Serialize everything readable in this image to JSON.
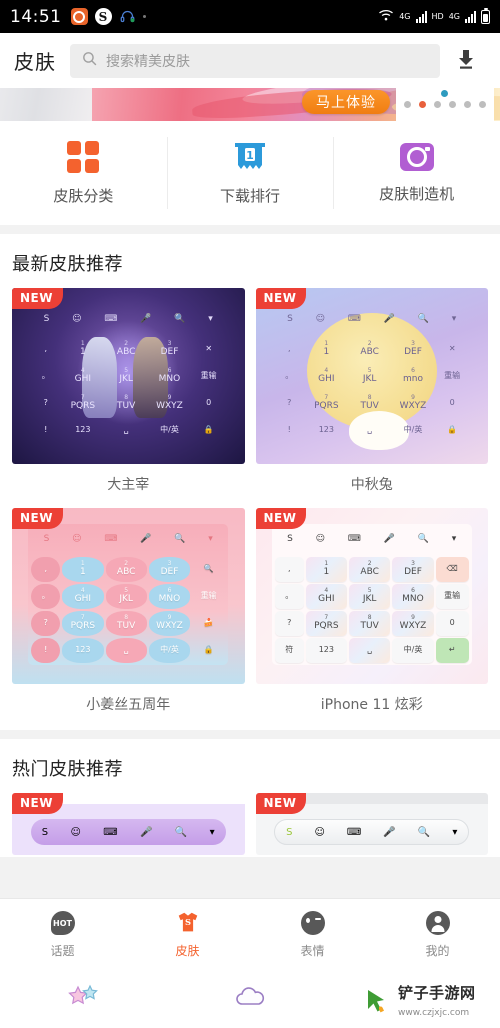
{
  "statusbar": {
    "time": "14:51",
    "left_icons": [
      "camera-app-icon",
      "s-app-icon",
      "headphone-icon",
      "dot-indicator"
    ],
    "right_icons": [
      "wifi-icon",
      "4g-signal-icon",
      "hd-icon",
      "4g-signal-2-icon",
      "battery-icon"
    ],
    "hd_label": "HD",
    "net_label": "4G"
  },
  "header": {
    "title": "皮肤",
    "search_placeholder": "搜索精美皮肤",
    "search_value": "",
    "download_icon": "download-icon"
  },
  "banner": {
    "cta_label": "马上体验",
    "dots_total": 6,
    "dots_active_index": 1,
    "accent_color": "#f07d12"
  },
  "quicknav": [
    {
      "label": "皮肤分类",
      "icon": "grid-icon",
      "color": "#f4622e"
    },
    {
      "label": "下载排行",
      "icon": "ranking-banner-icon",
      "color": "#2c9ada",
      "badge": "1"
    },
    {
      "label": "皮肤制造机",
      "icon": "camera-icon",
      "color": "#b15ed2"
    }
  ],
  "sections": [
    {
      "title": "最新皮肤推荐",
      "skins": [
        {
          "name": "大主宰",
          "badge": "NEW",
          "theme": "t1"
        },
        {
          "name": "中秋兔",
          "badge": "NEW",
          "theme": "t2"
        },
        {
          "name": "小姜丝五周年",
          "badge": "NEW",
          "theme": "t3"
        },
        {
          "name": "iPhone 11 炫彩",
          "badge": "NEW",
          "theme": "t4"
        }
      ]
    },
    {
      "title": "热门皮肤推荐",
      "skins": [
        {
          "name": "",
          "badge": "NEW",
          "theme": "h1"
        },
        {
          "name": "",
          "badge": "NEW",
          "theme": "h2"
        }
      ]
    }
  ],
  "keyboard_preview": {
    "toolbar_icons": [
      "sogou-logo-icon",
      "emoji-icon",
      "keyboard-icon",
      "mic-icon",
      "search-icon",
      "chevron-down-icon"
    ],
    "rows": [
      [
        ",",
        "1",
        "ABC",
        "DEF",
        "⌫"
      ],
      [
        "。",
        "GHI",
        "JKL",
        "MNO",
        "重输"
      ],
      [
        "?",
        "PQRS",
        "TUV",
        "WXYZ",
        "0"
      ],
      [
        "!",
        "123",
        "␣",
        "中/英",
        "↵"
      ]
    ],
    "nums": [
      "",
      "",
      "2",
      "3",
      "",
      "",
      "4",
      "5",
      "6",
      "",
      "",
      "7",
      "8",
      "9",
      ""
    ],
    "extra_keys": [
      "符",
      "123",
      "中/英",
      "0",
      "重输"
    ]
  },
  "tabbar": [
    {
      "label": "话题",
      "icon": "hot-topic-icon",
      "active": false
    },
    {
      "label": "皮肤",
      "icon": "skin-shirt-icon",
      "active": true
    },
    {
      "label": "表情",
      "icon": "emoji-face-icon",
      "active": false
    },
    {
      "label": "我的",
      "icon": "profile-icon",
      "active": false
    }
  ],
  "navbar": {
    "items": [
      "star-icon",
      "cloud-icon"
    ],
    "watermark_name": "铲子手游网",
    "watermark_url": "www.czjxjc.com"
  }
}
